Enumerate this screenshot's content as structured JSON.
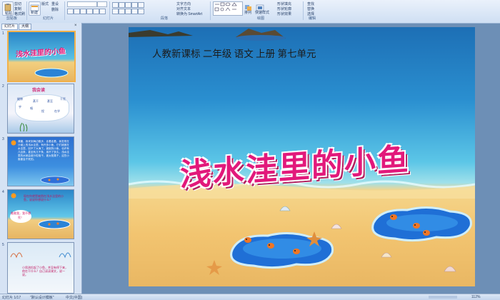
{
  "ribbon": {
    "paste_label": "粘贴",
    "cut_label": "剪切",
    "copy_label": "复制",
    "format_painter_label": "格式刷",
    "new_slide_label": "新建",
    "layout_label": "版式",
    "reset_label": "重设",
    "delete_label": "删除",
    "text_direction_label": "文字方向",
    "align_text_label": "对齐文本",
    "convert_smartart_label": "转换为 SmartArt",
    "arrange_label": "排列",
    "quick_styles_label": "快速样式",
    "shape_fill_label": "形状填充",
    "shape_outline_label": "形状轮廓",
    "shape_effects_label": "形状效果",
    "find_label": "查找",
    "replace_label": "替换",
    "select_label": "选择",
    "groups": {
      "clipboard": "剪贴板",
      "slides": "幻灯片",
      "paragraph": "段落",
      "drawing": "绘图",
      "editing": "编辑"
    }
  },
  "left_pane": {
    "tabs": [
      "幻灯片",
      "大纲"
    ],
    "close": "×",
    "slide_numbers": [
      "1",
      "2",
      "3",
      "4",
      "5"
    ],
    "thumb1_title": "浅水洼里的小鱼",
    "thumb2_heading": "我会读",
    "thumb2_words": [
      "缝隙",
      "蒸干",
      "甚至",
      "干死",
      "乎",
      "咽",
      "捏",
      "在乎"
    ],
    "thumb3_text": "清晨，我来到海边散步，走着走着，我发现在沙滩上的浅水洼里，有许多小鱼，它们被困在水洼里，回不了大海了。被困的小鱼，也许有几百条，甚至有几千条，用不了多久，浅水洼里的水就会被沙粒吸干，被太阳蒸干，这些小鱼都会干死的。",
    "thumb4_text": "现在你就是被困在浅水洼里的小鱼，说说你想说什么？",
    "thumb4_bubble": "救救我，我不想死！",
    "thumb5_text": "小男孩捡起了小鱼，并没有停下来，他在干什么？自己读读课文，说一说。"
  },
  "slide": {
    "subtitle": "人教新课标 二年级 语文 上册 第七单元",
    "title": "浅水洼里的小鱼"
  },
  "status": {
    "slide_count": "幻灯片 1/17",
    "theme": "\"默认设计模板\"",
    "language": "中文(中国)",
    "zoom": "112%"
  }
}
